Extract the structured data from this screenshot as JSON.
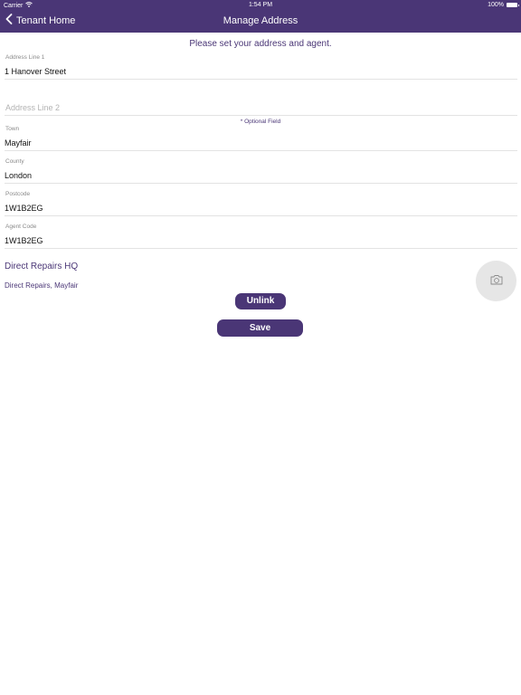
{
  "status_bar": {
    "carrier": "Carrier",
    "time": "1:54 PM",
    "battery": "100%"
  },
  "nav": {
    "back_label": "Tenant Home",
    "title": "Manage Address"
  },
  "instructions": "Please set your address and agent.",
  "form": {
    "address_line_1": {
      "label": "Address Line 1",
      "value": "1 Hanover Street"
    },
    "address_line_2": {
      "placeholder": "Address Line 2"
    },
    "optional_note": "* Optional Field",
    "town": {
      "label": "Town",
      "value": "Mayfair"
    },
    "county": {
      "label": "County",
      "value": "London"
    },
    "postcode": {
      "label": "Postcode",
      "value": "1W1B2EG"
    },
    "agent_code": {
      "label": "Agent Code",
      "value": "1W1B2EG"
    }
  },
  "agent": {
    "name": "Direct Repairs HQ",
    "detail": "Direct Repairs, Mayfair"
  },
  "buttons": {
    "unlink": "Unlink",
    "save": "Save"
  },
  "icons": {
    "back": "chevron-left-icon",
    "wifi": "wifi-icon",
    "battery": "battery-icon",
    "camera": "camera-icon"
  },
  "colors": {
    "brand": "#4a3676",
    "camera_bg": "#e6e6e6"
  }
}
